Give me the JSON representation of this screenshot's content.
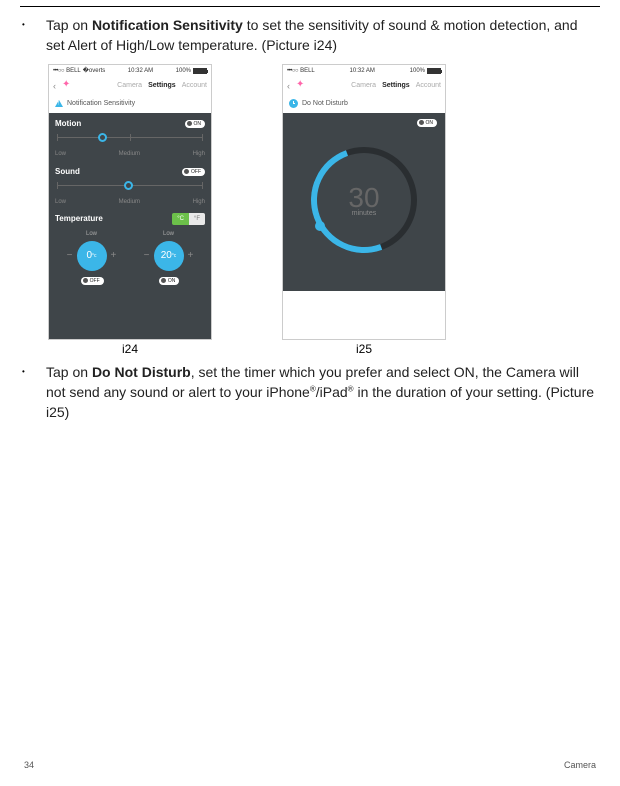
{
  "bullet1": {
    "pre": "Tap on ",
    "bold": "Notification Sensitivity",
    "post": " to set the sensitivity of sound & motion detection, and set Alert of High/Low temperature. (Picture i24)"
  },
  "bullet2": {
    "pre": "Tap on ",
    "bold": "Do Not Disturb",
    "post1": ", set the timer which you prefer and select ON, the Camera will not send any sound or alert to your iPhone",
    "reg1": "®",
    "mid": "/iPad",
    "reg2": "®",
    "post2": " in the duration of your setting. (Picture i25)"
  },
  "status": {
    "carrier": "BELL",
    "time": "10:32 AM",
    "batt": "100%"
  },
  "nav": {
    "camera": "Camera",
    "settings": "Settings",
    "account": "Account"
  },
  "i24": {
    "subhead": "Notification Sensitivity",
    "motion": "Motion",
    "sound": "Sound",
    "temperature": "Temperature",
    "low": "Low",
    "medium": "Medium",
    "high": "High",
    "on": "ON",
    "off": "OFF",
    "c": "°C",
    "f": "°F",
    "temp0": "0",
    "temp20": "20",
    "deg": "°c",
    "caption": "i24"
  },
  "i25": {
    "subhead": "Do Not Disturb",
    "on": "ON",
    "num": "30",
    "unit": "minutes",
    "caption": "i25"
  },
  "footer": {
    "page": "34",
    "section": "Camera"
  }
}
